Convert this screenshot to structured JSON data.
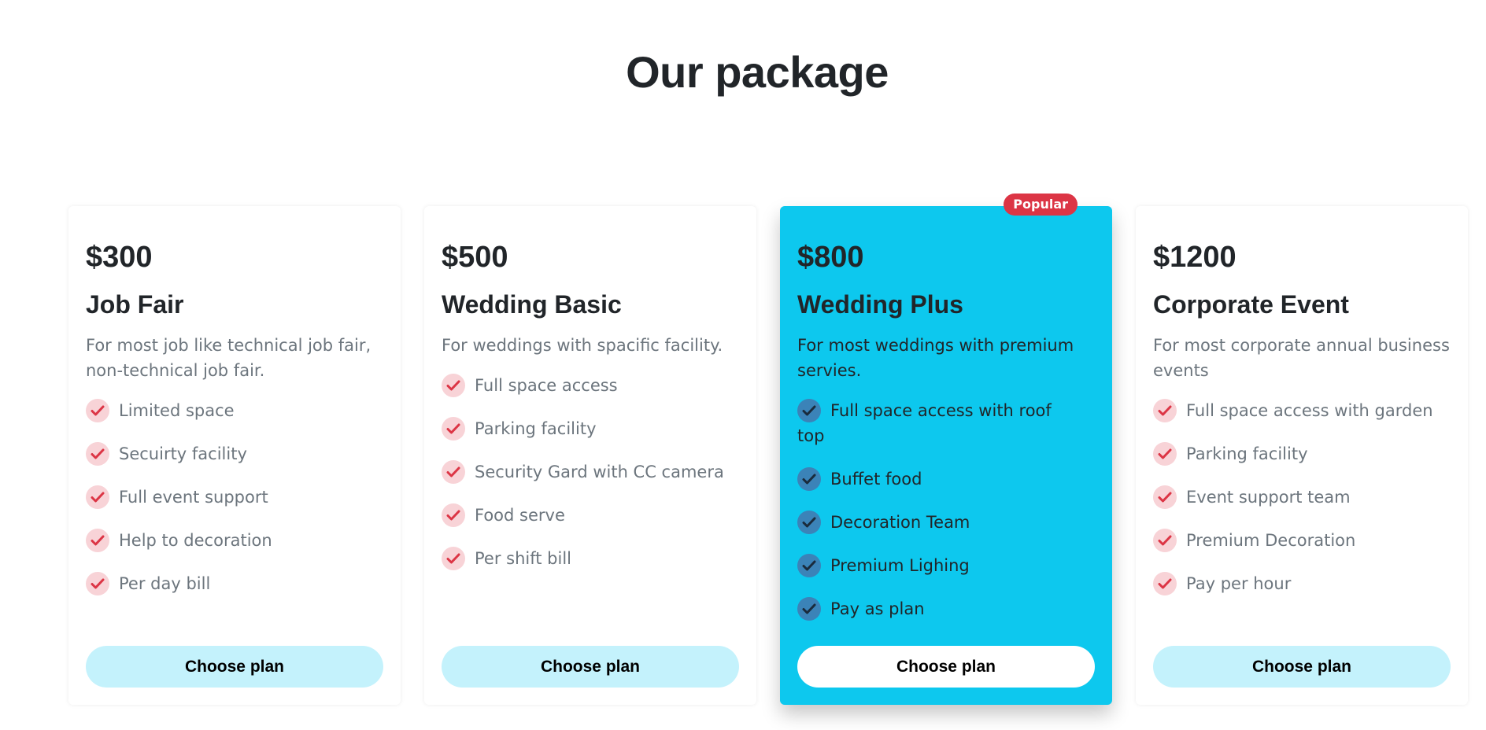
{
  "section": {
    "title": "Our package"
  },
  "colors": {
    "accent": "#0dc8ee",
    "badge": "#dc3545",
    "check_bg": "#f8d3d7",
    "check_mark": "#dc3545",
    "check_bg_highlight": "#3b83b8",
    "check_mark_highlight": "#1a2b3c",
    "button_bg": "#c4f2fc"
  },
  "plans": [
    {
      "price": "$300",
      "name": "Job Fair",
      "description": "For most job like technical job fair, non-technical job fair.",
      "features": [
        "Limited space",
        "Secuirty facility",
        "Full event support",
        "Help to decoration",
        "Per day bill"
      ],
      "button_label": "Choose plan"
    },
    {
      "price": "$500",
      "name": "Wedding Basic",
      "description": "For weddings with spacific facility.",
      "features": [
        "Full space access",
        "Parking facility",
        "Security Gard with CC camera",
        "Food serve",
        "Per shift bill"
      ],
      "button_label": "Choose plan"
    },
    {
      "price": "$800",
      "name": "Wedding Plus",
      "badge": "Popular",
      "description": "For most weddings with premium servies.",
      "features": [
        "Full space access with roof top",
        "Buffet food",
        "Decoration Team",
        "Premium Lighing",
        "Pay as plan"
      ],
      "button_label": "Choose plan"
    },
    {
      "price": "$1200",
      "name": "Corporate Event",
      "description": "For most corporate annual business events",
      "features": [
        "Full space access with garden",
        "Parking facility",
        "Event support team",
        "Premium Decoration",
        "Pay per hour"
      ],
      "button_label": "Choose plan"
    }
  ]
}
